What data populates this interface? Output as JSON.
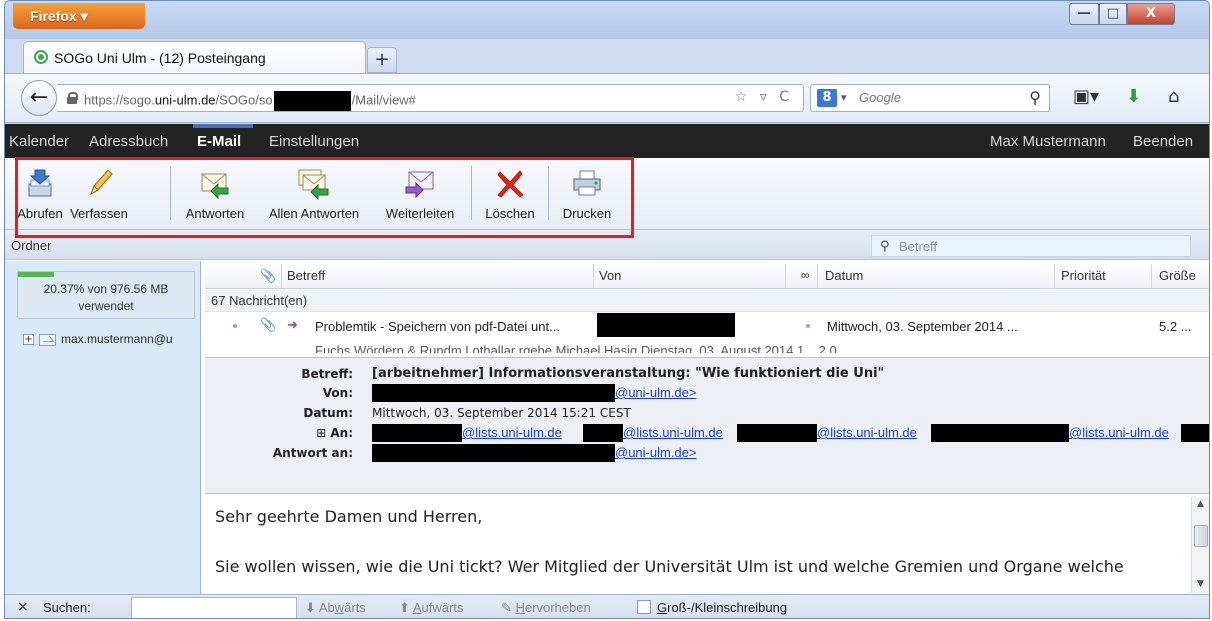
{
  "browser": {
    "menu_label": "Firefox ▾",
    "tab_title": "SOGo Uni Ulm - (12) Posteingang",
    "new_tab": "+",
    "url_prefix": "https://sogo.",
    "url_domain": "uni-ulm.de",
    "url_path1": "/SOGo/so",
    "url_path2": "/Mail/view#",
    "url_controls": "☆ ▿ C",
    "search_engine_letter": "8",
    "search_engine_caret": "▾",
    "search_placeholder": "Google",
    "window_controls": {
      "minimize": "—",
      "maximize": "□",
      "close": "X"
    }
  },
  "sogo": {
    "menu": {
      "kalender": "Kalender",
      "adressbuch": "Adressbuch",
      "email": "E-Mail",
      "einstellungen": "Einstellungen",
      "user": "Max Mustermann",
      "logout": "Beenden"
    },
    "toolbar": {
      "abrufen": "Abrufen",
      "verfassen": "Verfassen",
      "antworten": "Antworten",
      "allen_antworten": "Allen Antworten",
      "weiterleiten": "Weiterleiten",
      "loeschen": "Löschen",
      "drucken": "Drucken"
    },
    "folders_header": "Ordner",
    "filter_placeholder": "Betreff",
    "quota": {
      "line1": "20.37% von 976.56 MB",
      "line2": "verwendet",
      "fraction": 0.2037
    },
    "folder_account": "max.mustermann@u",
    "list": {
      "headers": {
        "subject": "Betreff",
        "from": "Von",
        "date": "Datum",
        "priority": "Priorität",
        "size": "Größe"
      },
      "count": "67 Nachricht(en)",
      "row1": {
        "subject": "Problemtik - Speichern von pdf-Datei unt...",
        "date": "Mittwoch, 03. September 2014 ...",
        "size": "5.2 ..."
      },
      "row2_partial": "Fuchs Wördern & Rundm Lothallar rgebe  Michael Hasig  Dienstag, 03. August 2014 1...  2.0 ..."
    },
    "preview": {
      "labels": {
        "subject": "Betreff:",
        "from": "Von:",
        "date": "Datum:",
        "to": "An:",
        "reply_to": "Antwort an:"
      },
      "subject": "[arbeitnehmer] Informationsveranstaltung: \"Wie funktioniert die Uni\"",
      "from_domain": "@uni-ulm.de>",
      "date": "Mittwoch, 03. September 2014 15:21 CEST",
      "to_domain": "@lists.uni-ulm.de",
      "reply_domain": "@uni-ulm.de>",
      "expander": "⊞"
    },
    "body": {
      "line1": "Sehr geehrte Damen und Herren,",
      "line2": "Sie wollen wissen, wie die Uni tickt? Wer Mitglied der Universität Ulm ist und welche Gremien und Organe welche"
    }
  },
  "findbar": {
    "close": "×",
    "label": "Suchen:",
    "down_pre": "Ab",
    "down_u": "w",
    "down_post": "ärts",
    "up_u": "A",
    "up_post": "ufwärts",
    "highlight_u": "H",
    "highlight_post": "ervorheben",
    "case_u": "G",
    "case_post": "roß-/Kleinschreibung"
  }
}
